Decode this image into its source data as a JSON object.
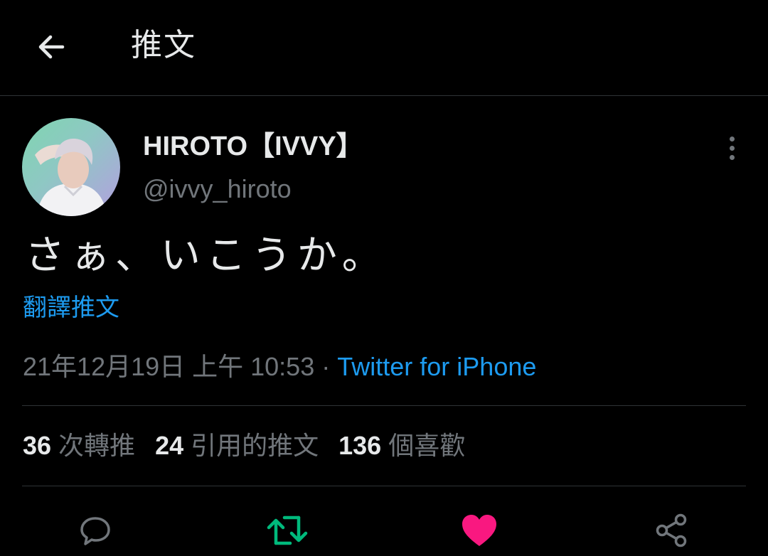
{
  "header": {
    "back_icon": "arrow-left-icon",
    "title": "推文"
  },
  "author": {
    "display_name": "HIROTO【IVVY】",
    "handle": "@ivvy_hiroto",
    "more_icon": "more-vertical-icon"
  },
  "tweet": {
    "text": "さぁ、いこうか。",
    "translate_label": "翻譯推文",
    "timestamp": "21年12月19日 上午 10:53",
    "separator": "·",
    "source": "Twitter for iPhone"
  },
  "stats": {
    "retweets": {
      "count": "36",
      "label": "次轉推"
    },
    "quotes": {
      "count": "24",
      "label": "引用的推文"
    },
    "likes": {
      "count": "136",
      "label": "個喜歡"
    }
  },
  "actions": {
    "reply_icon": "reply-icon",
    "retweet_icon": "retweet-icon",
    "like_icon": "heart-icon",
    "share_icon": "share-icon"
  },
  "colors": {
    "background": "#000000",
    "text_primary": "#e7e9ea",
    "text_secondary": "#71767b",
    "link": "#1d9bf0",
    "retweet_active": "#00ba7c",
    "like_active": "#f91880",
    "divider": "#2f3336"
  }
}
